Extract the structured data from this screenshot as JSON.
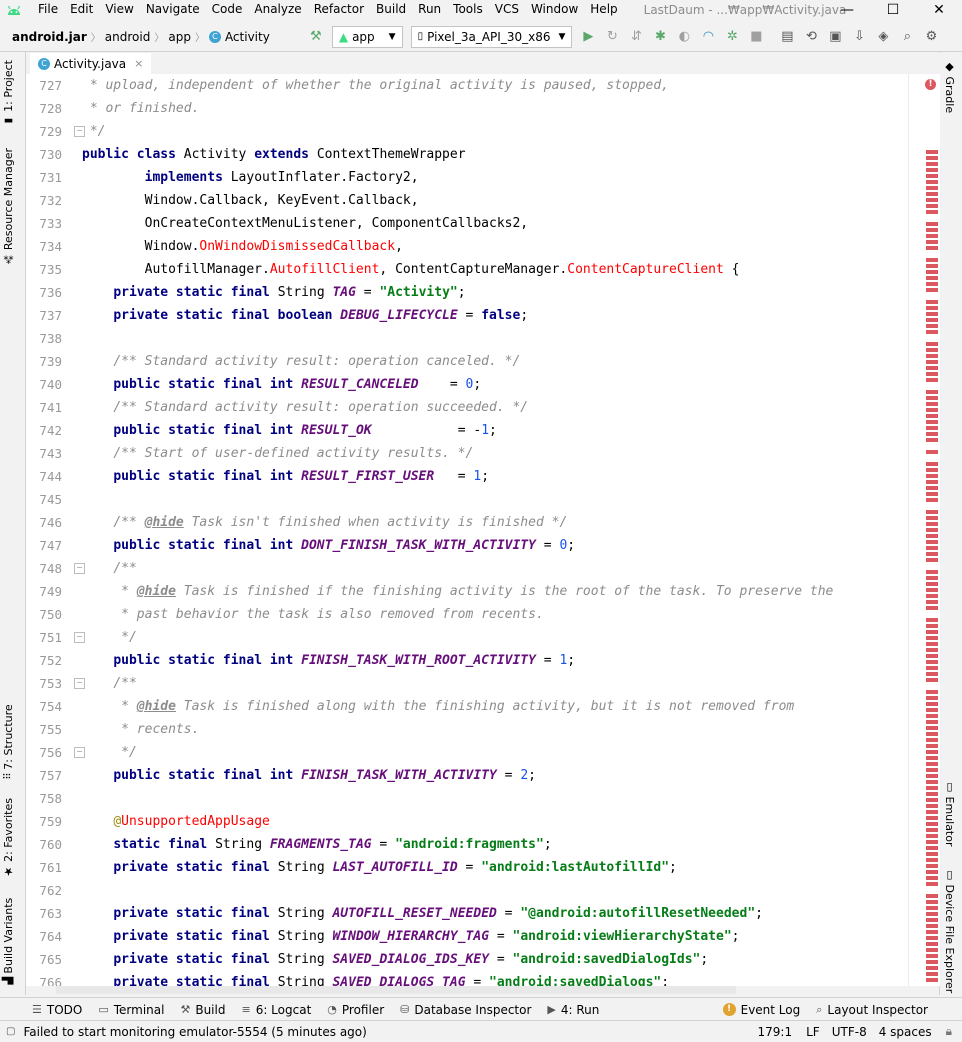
{
  "menubar": {
    "items": [
      "File",
      "Edit",
      "View",
      "Navigate",
      "Code",
      "Analyze",
      "Refactor",
      "Build",
      "Run",
      "Tools",
      "VCS",
      "Window",
      "Help"
    ],
    "window_title": "LastDaum - ...₩app₩Activity.java"
  },
  "window_controls": {
    "minimize": "—",
    "maximize": "☐",
    "close": "✕"
  },
  "navbar": {
    "breadcrumbs": [
      "android.jar",
      "android",
      "app",
      "Activity"
    ],
    "run_config": "app",
    "device": "Pixel_3a_API_30_x86"
  },
  "left_tabs": {
    "project": "1: Project",
    "resource_manager": "Resource Manager",
    "structure": "7: Structure",
    "favorites": "2: Favorites",
    "build_variants": "Build Variants"
  },
  "right_tabs": {
    "gradle": "Gradle",
    "emulator": "Emulator",
    "device_file_explorer": "Device File Explorer"
  },
  "editor_tab": {
    "label": "Activity.java",
    "close": "×"
  },
  "editor": {
    "line_numbers": [
      "727",
      "728",
      "729",
      "730",
      "731",
      "732",
      "733",
      "734",
      "735",
      "736",
      "737",
      "738",
      "739",
      "740",
      "741",
      "742",
      "743",
      "744",
      "745",
      "746",
      "747",
      "748",
      "749",
      "750",
      "751",
      "752",
      "753",
      "754",
      "755",
      "756",
      "757",
      "758",
      "759",
      "760",
      "761",
      "762",
      "763",
      "764",
      "765",
      "766"
    ],
    "lines": [
      [
        [
          "cm",
          " * upload, independent of whether the original activity is paused, stopped,"
        ]
      ],
      [
        [
          "cm",
          " * or finished."
        ]
      ],
      [
        [
          "cm",
          " */"
        ]
      ],
      [
        [
          "kw",
          "public class "
        ],
        [
          "",
          "Activity "
        ],
        [
          "kw",
          "extends "
        ],
        [
          "",
          "ContextThemeWrapper"
        ]
      ],
      [
        [
          "",
          "        "
        ],
        [
          "kw",
          "implements "
        ],
        [
          "",
          "LayoutInflater.Factory2,"
        ]
      ],
      [
        [
          "",
          "        Window.Callback, KeyEvent.Callback,"
        ]
      ],
      [
        [
          "",
          "        OnCreateContextMenuListener, ComponentCallbacks2,"
        ]
      ],
      [
        [
          "",
          "        Window."
        ],
        [
          "er",
          "OnWindowDismissedCallback"
        ],
        [
          "",
          ","
        ]
      ],
      [
        [
          "",
          "        AutofillManager."
        ],
        [
          "er",
          "AutofillClient"
        ],
        [
          "",
          ", ContentCaptureManager."
        ],
        [
          "er",
          "ContentCaptureClient"
        ],
        [
          "",
          " {"
        ]
      ],
      [
        [
          "",
          "    "
        ],
        [
          "kw",
          "private static final "
        ],
        [
          "",
          "String "
        ],
        [
          "fd",
          "TAG"
        ],
        [
          "",
          " = "
        ],
        [
          "st",
          "\"Activity\""
        ],
        [
          "",
          ";"
        ]
      ],
      [
        [
          "",
          "    "
        ],
        [
          "kw",
          "private static final boolean "
        ],
        [
          "fd",
          "DEBUG_LIFECYCLE"
        ],
        [
          "",
          " = "
        ],
        [
          "kw",
          "false"
        ],
        [
          "",
          ";"
        ]
      ],
      [],
      [
        [
          "",
          "    "
        ],
        [
          "cm",
          "/** Standard activity result: operation canceled. */"
        ]
      ],
      [
        [
          "",
          "    "
        ],
        [
          "kw",
          "public static final int "
        ],
        [
          "fd",
          "RESULT_CANCELED"
        ],
        [
          "",
          "    = "
        ],
        [
          "nm",
          "0"
        ],
        [
          "",
          ";"
        ]
      ],
      [
        [
          "",
          "    "
        ],
        [
          "cm",
          "/** Standard activity result: operation succeeded. */"
        ]
      ],
      [
        [
          "",
          "    "
        ],
        [
          "kw",
          "public static final int "
        ],
        [
          "fd",
          "RESULT_OK"
        ],
        [
          "",
          "           = -"
        ],
        [
          "nm",
          "1"
        ],
        [
          "",
          ";"
        ]
      ],
      [
        [
          "",
          "    "
        ],
        [
          "cm",
          "/** Start of user-defined activity results. */"
        ]
      ],
      [
        [
          "",
          "    "
        ],
        [
          "kw",
          "public static final int "
        ],
        [
          "fd",
          "RESULT_FIRST_USER"
        ],
        [
          "",
          "   = "
        ],
        [
          "nm",
          "1"
        ],
        [
          "",
          ";"
        ]
      ],
      [],
      [
        [
          "",
          "    "
        ],
        [
          "cm",
          "/** "
        ],
        [
          "tag",
          "@hide"
        ],
        [
          "cm",
          " Task isn't finished when activity is finished */"
        ]
      ],
      [
        [
          "",
          "    "
        ],
        [
          "kw",
          "public static final int "
        ],
        [
          "fd",
          "DONT_FINISH_TASK_WITH_ACTIVITY"
        ],
        [
          "",
          " = "
        ],
        [
          "nm",
          "0"
        ],
        [
          "",
          ";"
        ]
      ],
      [
        [
          "",
          "    "
        ],
        [
          "cm",
          "/**"
        ]
      ],
      [
        [
          "",
          "     "
        ],
        [
          "cm",
          "* "
        ],
        [
          "tag",
          "@hide"
        ],
        [
          "cm",
          " Task is finished if the finishing activity is the root of the task. To preserve the"
        ]
      ],
      [
        [
          "",
          "     "
        ],
        [
          "cm",
          "* past behavior the task is also removed from recents."
        ]
      ],
      [
        [
          "",
          "     "
        ],
        [
          "cm",
          "*/"
        ]
      ],
      [
        [
          "",
          "    "
        ],
        [
          "kw",
          "public static final int "
        ],
        [
          "fd",
          "FINISH_TASK_WITH_ROOT_ACTIVITY"
        ],
        [
          "",
          " = "
        ],
        [
          "nm",
          "1"
        ],
        [
          "",
          ";"
        ]
      ],
      [
        [
          "",
          "    "
        ],
        [
          "cm",
          "/**"
        ]
      ],
      [
        [
          "",
          "     "
        ],
        [
          "cm",
          "* "
        ],
        [
          "tag",
          "@hide"
        ],
        [
          "cm",
          " Task is finished along with the finishing activity, but it is not removed from"
        ]
      ],
      [
        [
          "",
          "     "
        ],
        [
          "cm",
          "* recents."
        ]
      ],
      [
        [
          "",
          "     "
        ],
        [
          "cm",
          "*/"
        ]
      ],
      [
        [
          "",
          "    "
        ],
        [
          "kw",
          "public static final int "
        ],
        [
          "fd",
          "FINISH_TASK_WITH_ACTIVITY"
        ],
        [
          "",
          " = "
        ],
        [
          "nm",
          "2"
        ],
        [
          "",
          ";"
        ]
      ],
      [],
      [
        [
          "",
          "    "
        ],
        [
          "an",
          "@"
        ],
        [
          "er",
          "UnsupportedAppUsage"
        ]
      ],
      [
        [
          "",
          "    "
        ],
        [
          "kw",
          "static final "
        ],
        [
          "",
          "String "
        ],
        [
          "fd",
          "FRAGMENTS_TAG"
        ],
        [
          "",
          " = "
        ],
        [
          "st",
          "\"android:fragments\""
        ],
        [
          "",
          ";"
        ]
      ],
      [
        [
          "",
          "    "
        ],
        [
          "kw",
          "private static final "
        ],
        [
          "",
          "String "
        ],
        [
          "fd",
          "LAST_AUTOFILL_ID"
        ],
        [
          "",
          " = "
        ],
        [
          "st",
          "\"android:lastAutofillId\""
        ],
        [
          "",
          ";"
        ]
      ],
      [],
      [
        [
          "",
          "    "
        ],
        [
          "kw",
          "private static final "
        ],
        [
          "",
          "String "
        ],
        [
          "fd",
          "AUTOFILL_RESET_NEEDED"
        ],
        [
          "",
          " = "
        ],
        [
          "st",
          "\"@android:autofillResetNeeded\""
        ],
        [
          "",
          ";"
        ]
      ],
      [
        [
          "",
          "    "
        ],
        [
          "kw",
          "private static final "
        ],
        [
          "",
          "String "
        ],
        [
          "fd",
          "WINDOW_HIERARCHY_TAG"
        ],
        [
          "",
          " = "
        ],
        [
          "st",
          "\"android:viewHierarchyState\""
        ],
        [
          "",
          ";"
        ]
      ],
      [
        [
          "",
          "    "
        ],
        [
          "kw",
          "private static final "
        ],
        [
          "",
          "String "
        ],
        [
          "fd",
          "SAVED_DIALOG_IDS_KEY"
        ],
        [
          "",
          " = "
        ],
        [
          "st",
          "\"android:savedDialogIds\""
        ],
        [
          "",
          ";"
        ]
      ],
      [
        [
          "",
          "    "
        ],
        [
          "kw",
          "private static final "
        ],
        [
          "",
          "String "
        ],
        [
          "fd",
          "SAVED_DIALOGS_TAG"
        ],
        [
          "",
          " = "
        ],
        [
          "st",
          "\"android:savedDialogs\""
        ],
        [
          "",
          ";"
        ]
      ]
    ]
  },
  "bottom_tools": [
    {
      "icon": "list-icon",
      "glyph": "☰",
      "label": "TODO"
    },
    {
      "icon": "terminal-icon",
      "glyph": "▭",
      "label": "Terminal"
    },
    {
      "icon": "hammer-icon",
      "glyph": "⚒",
      "label": "Build"
    },
    {
      "icon": "logcat-icon",
      "glyph": "≡",
      "label": "6: Logcat"
    },
    {
      "icon": "profiler-icon",
      "glyph": "◔",
      "label": "Profiler"
    },
    {
      "icon": "database-icon",
      "glyph": "⛁",
      "label": "Database Inspector"
    },
    {
      "icon": "run-icon",
      "glyph": "▶",
      "label": "4: Run"
    }
  ],
  "bottom_right_tools": [
    {
      "icon": "event-log-icon",
      "glyph": "!",
      "label": "Event Log"
    },
    {
      "icon": "layout-inspector-icon",
      "glyph": "⌕",
      "label": "Layout Inspector"
    }
  ],
  "status": {
    "message": "Failed to start monitoring emulator-5554 (5 minutes ago)",
    "position": "179:1",
    "line_separator": "LF",
    "encoding": "UTF-8",
    "indent": "4 spaces"
  },
  "colors": {
    "keyword": "#000080",
    "comment": "#8c8c8c",
    "string": "#067d17",
    "field": "#660e7a",
    "number": "#1750eb",
    "error": "#ff0000",
    "annotation": "#9e880d",
    "accent": "#4083c9",
    "android_green": "#3ddc84",
    "error_stripe": "#db5860"
  }
}
